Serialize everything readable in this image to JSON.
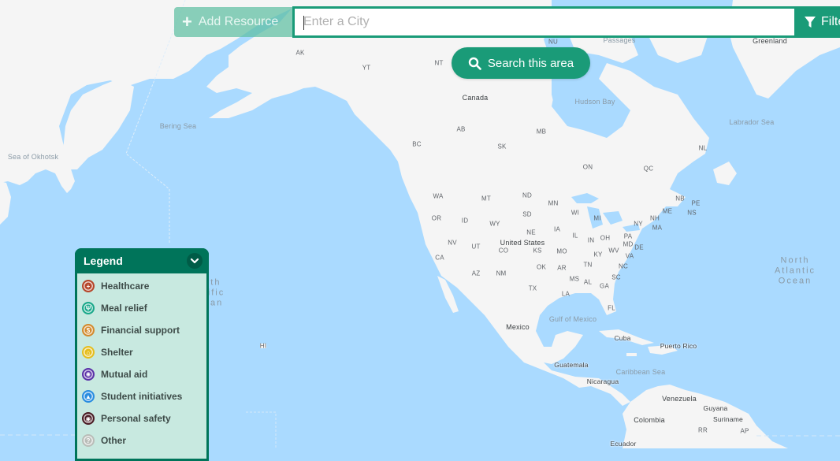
{
  "toolbar": {
    "add_resource_label": "Add Resource",
    "city_placeholder": "Enter a City",
    "city_value": "",
    "filter_label": "Filter",
    "search_area_label": "Search this area"
  },
  "colors": {
    "accent": "#1a9b78",
    "legend_header": "#00745a",
    "legend_bg": "#c8e9e0",
    "water": "#aadaff",
    "land": "#f5f5f5"
  },
  "legend": {
    "title": "Legend",
    "toggle_icon": "chevron-down-icon",
    "items": [
      {
        "label": "Healthcare",
        "icon": "medical-cross-icon",
        "color": "#b5462a"
      },
      {
        "label": "Meal relief",
        "icon": "fork-knife-icon",
        "color": "#1aa88a"
      },
      {
        "label": "Financial support",
        "icon": "dollar-icon",
        "color": "#d38a2e"
      },
      {
        "label": "Shelter",
        "icon": "house-icon",
        "color": "#e5bd1e"
      },
      {
        "label": "Mutual aid",
        "icon": "hands-icon",
        "color": "#5b33a8"
      },
      {
        "label": "Student initiatives",
        "icon": "graduation-cap-icon",
        "color": "#2a8de0"
      },
      {
        "label": "Personal safety",
        "icon": "shield-icon",
        "color": "#4a1c24"
      },
      {
        "label": "Other",
        "icon": "question-icon",
        "color": "#b9bdb8"
      }
    ]
  },
  "map": {
    "labels": {
      "countries": [
        "Canada",
        "United States",
        "Mexico",
        "Greenland",
        "Cuba",
        "Puerto Rico",
        "Guatemala",
        "Nicaragua",
        "Venezuela",
        "Colombia",
        "Guyana",
        "Suriname",
        "Ecuador"
      ],
      "water": [
        "Bering Sea",
        "Sea of Okhotsk",
        "Hudson Bay",
        "Labrador Sea",
        "Gulf of Mexico",
        "Caribbean Sea",
        "Passages"
      ],
      "oceans": [
        "North Atlantic Ocean",
        "North Pacific Ocean"
      ],
      "regions": [
        "AK",
        "YT",
        "NT",
        "NU",
        "BC",
        "AB",
        "SK",
        "MB",
        "ON",
        "QC",
        "NL",
        "NB",
        "PE",
        "NS",
        "WA",
        "OR",
        "CA",
        "NV",
        "ID",
        "MT",
        "WY",
        "UT",
        "CO",
        "AZ",
        "NM",
        "ND",
        "SD",
        "NE",
        "KS",
        "OK",
        "TX",
        "MN",
        "IA",
        "MO",
        "AR",
        "LA",
        "WI",
        "IL",
        "MI",
        "IN",
        "OH",
        "KY",
        "TN",
        "MS",
        "AL",
        "GA",
        "FL",
        "SC",
        "NC",
        "VA",
        "WV",
        "MD",
        "DE",
        "PA",
        "NY",
        "NH",
        "MA",
        "ME",
        "HI",
        "RR",
        "AP"
      ]
    }
  }
}
